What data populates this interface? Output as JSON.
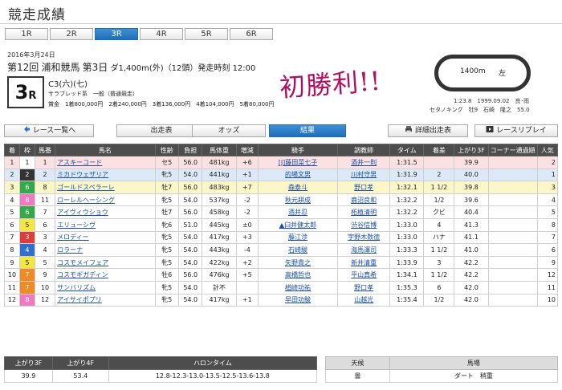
{
  "page": {
    "title": "競走成績"
  },
  "race_tabs": [
    {
      "label": "1R",
      "active": false
    },
    {
      "label": "2R",
      "active": false
    },
    {
      "label": "3R",
      "active": true
    },
    {
      "label": "4R",
      "active": false
    },
    {
      "label": "5R",
      "active": false
    },
    {
      "label": "6R",
      "active": false
    }
  ],
  "race": {
    "date": "2016年3月24日",
    "kai": "第12回",
    "venue": "浦和競馬",
    "day": "第3日",
    "detail": "ダ1,400m(外)（12頭）発走時刻 12:00",
    "number": "3",
    "number_suffix": "R",
    "grade": "C3(六)(七)",
    "conditions": "サラブレッド系　一般（普通競走）",
    "prizes": "賞金　1着800,000円　2着240,000円　3着136,000円　4着104,000円　5着80,000円",
    "handwritten_note": "初勝利!!",
    "course_label": "1400m",
    "course_direction": "左",
    "record_line": "1:23.8　1999.09.02　良･雨",
    "record_holder": "セタノキング　牡9　石崎　隆之　55.0"
  },
  "nav": {
    "back_label": "レース一覧へ",
    "entries_label": "出走表",
    "odds_label": "オッズ",
    "results_label": "結果",
    "detail_entries_label": "詳細出走表",
    "replay_label": "レースリプレイ"
  },
  "results_headers": [
    "着",
    "枠",
    "馬番",
    "馬名",
    "性齢",
    "負担",
    "馬体重",
    "増減",
    "騎手",
    "調教師",
    "タイム",
    "着差",
    "上がり3F",
    "コーナー通過順",
    "人気"
  ],
  "results": [
    {
      "pos": "1",
      "waku": "1",
      "num": "1",
      "horse": "アスキーコード",
      "sexage": "セ5",
      "weight": "56.0",
      "body": "481kg",
      "diff": "+6",
      "jockey": "[J]藤田菜七子",
      "trainer": "酒井一則",
      "time": "1:31.5",
      "margin": "",
      "last3f": "39.9",
      "corner": "",
      "pop": "2"
    },
    {
      "pos": "2",
      "waku": "2",
      "num": "2",
      "horse": "ミカドウェザリア",
      "sexage": "牝5",
      "weight": "54.0",
      "body": "441kg",
      "diff": "+1",
      "jockey": "的場文男",
      "trainer": "川村守男",
      "time": "1:31.9",
      "margin": "2",
      "last3f": "40.0",
      "corner": "",
      "pop": "1"
    },
    {
      "pos": "3",
      "waku": "6",
      "num": "8",
      "horse": "ゴールドスペラーレ",
      "sexage": "牡7",
      "weight": "56.0",
      "body": "483kg",
      "diff": "+7",
      "jockey": "森泰斗",
      "trainer": "野口孝",
      "time": "1:32.1",
      "margin": "1 1/2",
      "last3f": "39.8",
      "corner": "",
      "pop": "3"
    },
    {
      "pos": "4",
      "waku": "8",
      "num": "11",
      "horse": "ローレルヘーシング",
      "sexage": "牝5",
      "weight": "54.0",
      "body": "537kg",
      "diff": "-2",
      "jockey": "秋元耕成",
      "trainer": "鹿沼良和",
      "time": "1:32.2",
      "margin": "1/2",
      "last3f": "39.6",
      "corner": "",
      "pop": "4"
    },
    {
      "pos": "5",
      "waku": "6",
      "num": "7",
      "horse": "アイヴィウショウ",
      "sexage": "牡7",
      "weight": "56.0",
      "body": "458kg",
      "diff": "-2",
      "jockey": "酒井忍",
      "trainer": "柘植清明",
      "time": "1:32.2",
      "margin": "クビ",
      "last3f": "40.4",
      "corner": "",
      "pop": "5"
    },
    {
      "pos": "6",
      "waku": "5",
      "num": "6",
      "horse": "エリューシヴ",
      "sexage": "牝6",
      "weight": "51.0",
      "body": "445kg",
      "diff": "±0",
      "jockey": "▲臼井健太郎",
      "trainer": "渋谷信博",
      "time": "1:33.0",
      "margin": "4",
      "last3f": "41.3",
      "corner": "",
      "pop": "8"
    },
    {
      "pos": "7",
      "waku": "3",
      "num": "3",
      "horse": "メロディー",
      "sexage": "牝5",
      "weight": "54.0",
      "body": "417kg",
      "diff": "+3",
      "jockey": "藤江渉",
      "trainer": "宇野木数徳",
      "time": "1:33.0",
      "margin": "ハナ",
      "last3f": "41.1",
      "corner": "",
      "pop": "7"
    },
    {
      "pos": "8",
      "waku": "4",
      "num": "4",
      "horse": "ロラーナ",
      "sexage": "牝5",
      "weight": "54.0",
      "body": "443kg",
      "diff": "-4",
      "jockey": "石崎駿",
      "trainer": "海馬澤司",
      "time": "1:33.3",
      "margin": "1 1/2",
      "last3f": "41.0",
      "corner": "",
      "pop": "6"
    },
    {
      "pos": "9",
      "waku": "5",
      "num": "5",
      "horse": "コスモメイフェア",
      "sexage": "牝5",
      "weight": "54.0",
      "body": "422kg",
      "diff": "+2",
      "jockey": "矢野貴之",
      "trainer": "新井清重",
      "time": "1:33.9",
      "margin": "3",
      "last3f": "42.2",
      "corner": "",
      "pop": "9"
    },
    {
      "pos": "10",
      "waku": "7",
      "num": "9",
      "horse": "コスモギガディン",
      "sexage": "牡6",
      "weight": "56.0",
      "body": "476kg",
      "diff": "+5",
      "jockey": "高橋哲也",
      "trainer": "平山真希",
      "time": "1:34.1",
      "margin": "1 1/2",
      "last3f": "42.2",
      "corner": "",
      "pop": "12"
    },
    {
      "pos": "11",
      "waku": "7",
      "num": "10",
      "horse": "サンバリズム",
      "sexage": "牝5",
      "weight": "54.0",
      "body": "計不",
      "diff": "",
      "jockey": "楢崎功祐",
      "trainer": "野口孝",
      "time": "1:35.3",
      "margin": "6",
      "last3f": "42.0",
      "corner": "",
      "pop": "11"
    },
    {
      "pos": "12",
      "waku": "8",
      "num": "12",
      "horse": "アイサイポプリ",
      "sexage": "牝5",
      "weight": "54.0",
      "body": "417kg",
      "diff": "+1",
      "jockey": "早田功駿",
      "trainer": "山越光",
      "time": "1:35.4",
      "margin": "1/2",
      "last3f": "42.0",
      "corner": "",
      "pop": "10"
    }
  ],
  "lap": {
    "headers": [
      "上がり3F",
      "上がり4F",
      "ハロンタイム"
    ],
    "values": [
      "39.9",
      "53.4",
      "12.8-12.3-13.0-13.5-12.5-13.6-13.8"
    ]
  },
  "weather": {
    "headers": [
      "天候",
      "馬場"
    ],
    "values": [
      "曇",
      "ダート　稍重"
    ]
  }
}
